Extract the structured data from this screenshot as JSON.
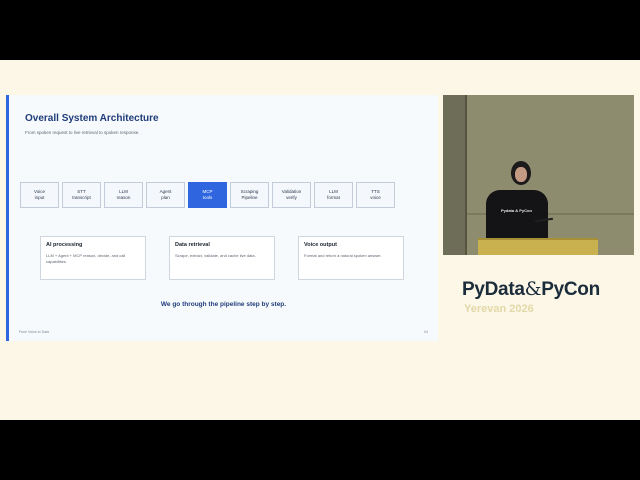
{
  "slide": {
    "title": "Overall System Architecture",
    "subtitle": "From spoken request to live retrieval to spoken response.",
    "pipeline": [
      {
        "line1": "Voice",
        "line2": "input",
        "active": false
      },
      {
        "line1": "STT",
        "line2": "transcript",
        "active": false
      },
      {
        "line1": "LLM",
        "line2": "reason",
        "active": false
      },
      {
        "line1": "Agent",
        "line2": "plan",
        "active": false
      },
      {
        "line1": "MCP",
        "line2": "tools",
        "active": true
      },
      {
        "line1": "Scraping",
        "line2": "Pipeline",
        "active": false
      },
      {
        "line1": "Validation",
        "line2": "verify",
        "active": false
      },
      {
        "line1": "LLM",
        "line2": "format",
        "active": false
      },
      {
        "line1": "TTS",
        "line2": "voice",
        "active": false
      }
    ],
    "cards": [
      {
        "title": "AI processing",
        "body": "LLM + Agent + MCP reason, decide, and call capabilities."
      },
      {
        "title": "Data retrieval",
        "body": "Scrape, extract, validate, and cache live data."
      },
      {
        "title": "Voice output",
        "body": "Format and return a natural spoken answer."
      }
    ],
    "tagline": "We go through the pipeline step by step.",
    "footer_left": "From Voice to Data",
    "footer_right": "04"
  },
  "camera": {
    "shirt_text": "Pydata & PyCon"
  },
  "brand": {
    "part1": "PyData",
    "amp": "&",
    "part2": "PyCon",
    "subtitle": "Yerevan 2026"
  },
  "colors": {
    "accent": "#2f66e0",
    "title": "#1f3c7a",
    "frame_bg": "#fcf7e7",
    "letterbox": "#000000"
  }
}
